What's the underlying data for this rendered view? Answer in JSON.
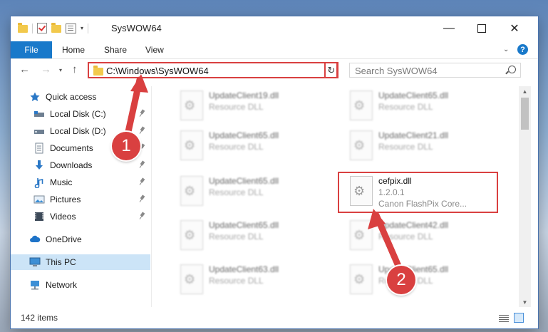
{
  "window": {
    "title": "SysWOW64"
  },
  "ribbon": {
    "tabs": [
      "File",
      "Home",
      "Share",
      "View"
    ]
  },
  "address": {
    "path": "C:\\Windows\\SysWOW64",
    "search_placeholder": "Search SysWOW64"
  },
  "nav": {
    "items": [
      {
        "label": "Quick access",
        "icon": "star-icon",
        "pinned": false
      },
      {
        "label": "Local Disk (C:)",
        "icon": "drive-icon",
        "pinned": true
      },
      {
        "label": "Local Disk (D:)",
        "icon": "drive-icon",
        "pinned": true
      },
      {
        "label": "Documents",
        "icon": "documents-icon",
        "pinned": true
      },
      {
        "label": "Downloads",
        "icon": "download-icon",
        "pinned": true
      },
      {
        "label": "Music",
        "icon": "music-icon",
        "pinned": true
      },
      {
        "label": "Pictures",
        "icon": "pictures-icon",
        "pinned": true
      },
      {
        "label": "Videos",
        "icon": "videos-icon",
        "pinned": true
      },
      {
        "label": "OneDrive",
        "icon": "cloud-icon",
        "pinned": false
      },
      {
        "label": "This PC",
        "icon": "computer-icon",
        "pinned": false,
        "selected": true
      },
      {
        "label": "Network",
        "icon": "network-icon",
        "pinned": false
      }
    ]
  },
  "files": [
    {
      "name": "UpdateClient19.dll",
      "type": "Resource DLL"
    },
    {
      "name": "UpdateClient65.dll",
      "type": "Resource DLL"
    },
    {
      "name": "UpdateClient65.dll",
      "type": "Resource DLL"
    },
    {
      "name": "UpdateClient21.dll",
      "type": "Resource DLL"
    },
    {
      "name": "UpdateClient65.dll",
      "type": "Resource DLL"
    },
    {
      "name": "cefpix.dll",
      "version": "1.2.0.1",
      "description": "Canon FlashPix Core..."
    },
    {
      "name": "UpdateClient65.dll",
      "type": "Resource DLL"
    },
    {
      "name": "UpdateClient42.dll",
      "type": "Resource DLL"
    },
    {
      "name": "UpdateClient63.dll",
      "type": "Resource DLL"
    },
    {
      "name": "UpdateClient65.dll",
      "type": "Resource DLL"
    }
  ],
  "status": {
    "item_count": "142 items"
  },
  "annotations": {
    "step1": "1",
    "step2": "2"
  },
  "colors": {
    "accent": "#1979ca",
    "annotation": "#d94040",
    "selected": "#cce4f7"
  }
}
